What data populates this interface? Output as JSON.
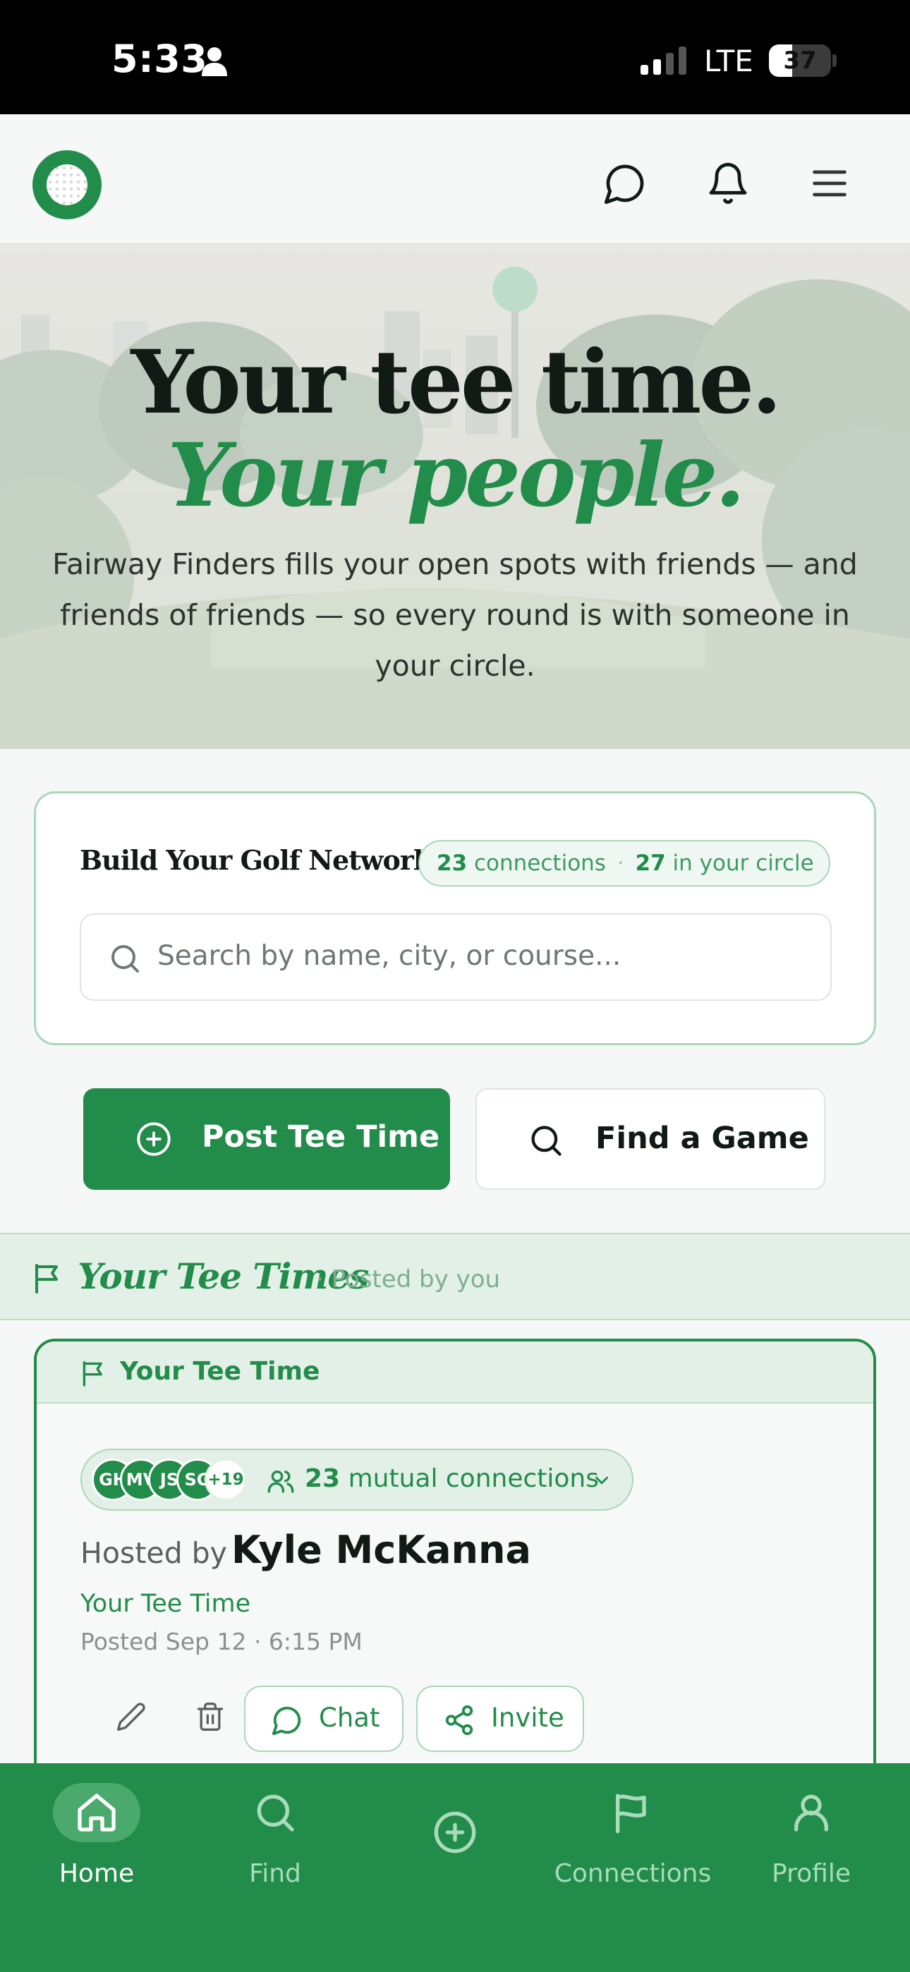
{
  "status_bar": {
    "time": "5:33",
    "network": "LTE",
    "battery": "37",
    "battery_level": 0.37
  },
  "brand": {
    "primary_color": "#228c4a",
    "icons": [
      "logo",
      "chat-bubble-icon",
      "bell-icon",
      "menu-icon"
    ]
  },
  "hero": {
    "title_line1": "Your tee time.",
    "title_line2": "Your people.",
    "subtitle": "Fairway Finders fills your open spots with friends — and friends of friends — so every round is with someone in your circle."
  },
  "network": {
    "title": "Build Your Golf Network",
    "connections_count": "23",
    "connections_label": "connections",
    "circle_count": "27",
    "circle_label": "in your circle",
    "search_placeholder": "Search by name, city, or course..."
  },
  "actions": {
    "post_label": "Post Tee Time",
    "find_label": "Find a Game"
  },
  "section": {
    "title": "Your Tee Times",
    "subtitle": "· Posted by you"
  },
  "tee_card": {
    "header_label": "Your Tee Time",
    "avatars": [
      "GH",
      "MV",
      "JS",
      "SG"
    ],
    "avatars_more": "+19",
    "mutual_count": "23",
    "mutual_label": "mutual connections",
    "hosted_by_label": "Hosted by",
    "host_name": "Kyle McKanna",
    "subtitle": "Your Tee Time",
    "posted": "Posted Sep 12 · 6:15 PM",
    "chat_label": "Chat",
    "invite_label": "Invite"
  },
  "tab_bar": {
    "active": "Home",
    "items": [
      {
        "label": "Home",
        "icon": "home-icon"
      },
      {
        "label": "Find",
        "icon": "search-icon"
      },
      {
        "label": "",
        "icon": "plus-circle-icon"
      },
      {
        "label": "Connections",
        "icon": "flag-icon"
      },
      {
        "label": "Profile",
        "icon": "user-icon"
      }
    ]
  }
}
